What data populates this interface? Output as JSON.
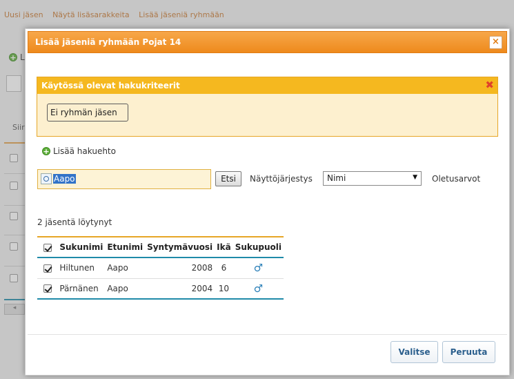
{
  "background": {
    "links": [
      "Uusi jäsen",
      "Näytä lisäsarakkeita",
      "Lisää jäseniä ryhmään"
    ],
    "add_label": "L",
    "col_label": "Siir"
  },
  "dialog": {
    "title": "Lisää jäseniä ryhmään Pojat 14",
    "close_glyph": "×",
    "criteria": {
      "header": "Käytössä olevat hakukriteerit",
      "remove_glyph": "✖",
      "chip": "Ei ryhmän jäsen"
    },
    "add_condition": "Lisää hakuehto",
    "search": {
      "value": "Aapo",
      "button": "Etsi"
    },
    "order": {
      "label": "Näyttöjärjestys",
      "selected": "Nimi",
      "defaults": "Oletusarvot"
    },
    "found_text": "2 jäsentä löytynyt",
    "table": {
      "headers": [
        "Sukunimi",
        "Etunimi",
        "Syntymävuosi",
        "Ikä",
        "Sukupuoli"
      ],
      "rows": [
        {
          "surname": "Hiltunen",
          "firstname": "Aapo",
          "birth_year": "2008",
          "age": "6",
          "gender": "male",
          "gender_glyph": "♂",
          "checked": true
        },
        {
          "surname": "Pärnänen",
          "firstname": "Aapo",
          "birth_year": "2004",
          "age": "10",
          "gender": "male",
          "gender_glyph": "♂",
          "checked": true
        }
      ]
    },
    "buttons": {
      "select": "Valitse",
      "cancel": "Peruuta"
    }
  },
  "colors": {
    "accent_orange": "#ee8a1c",
    "criteria_yellow": "#f5b81f",
    "table_line": "#1f8aa8",
    "button_text": "#2b5f8d"
  }
}
